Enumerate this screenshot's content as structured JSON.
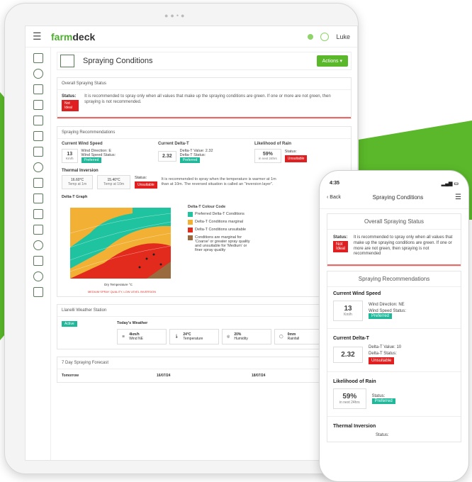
{
  "tablet": {
    "logo_a": "farm",
    "logo_b": "deck",
    "user": "Luke",
    "page_title": "Spraying Conditions",
    "actions": "Actions ▾",
    "overall": {
      "heading": "Overall Spraying Status",
      "status_label": "Status:",
      "status_value": "Not Ideal",
      "message": "It is recommended to spray only when all values that make up the spraying conditions are green. If one or more are not green, then spraying is not recommended."
    },
    "recs": {
      "heading": "Spraying Recommendations",
      "wind": {
        "title": "Current Wind Speed",
        "value": "13",
        "unit": "Km/h",
        "direction_label": "Wind Direction: E",
        "status_label": "Wind Speed Status:",
        "status": "Preferred"
      },
      "delta": {
        "title": "Current Delta-T",
        "value": "2.32",
        "dt_label": "Delta-T Value: 2.32",
        "status_label": "Delta-T Status:",
        "status": "Preferred"
      },
      "rain": {
        "title": "Likelihood of Rain",
        "value": "59%",
        "sub": "in next 24hrs",
        "status_label": "Status:",
        "status": "Unsuitable"
      }
    },
    "thermal": {
      "title": "Thermal Inversion",
      "t1": "16.60°C",
      "t1_sub": "Temp at 1m",
      "t2": "15.40°C",
      "t2_sub": "Temp at 10m",
      "status_label": "Status:",
      "status": "Unsuitable",
      "message": "It is recommended to spray when the temperature is warmer at 1m than at 10m. The reversed situation is called an \"inversion layer\"."
    },
    "graph": {
      "title": "Delta-T Graph",
      "legend_title": "Delta-T Colour Code",
      "legend": [
        {
          "label": "Preferred Delta-T Conditions",
          "color": "#1fc3a0"
        },
        {
          "label": "Delta-T Conditions marginal",
          "color": "#f2b134"
        },
        {
          "label": "Delta-T Conditions unsuitable",
          "color": "#e22b1d"
        },
        {
          "label": "Conditions are marginal for 'Coarse' or greater spray quality and unsuitable for 'Medium' or finer spray quality",
          "color": "#9a6b3f"
        }
      ],
      "xlabel": "Dry Temperature °C",
      "footer": "MEDIUM SPRAY QUALITY, LOW LEVEL INVERSION"
    },
    "weather": {
      "heading": "Llanelli Weather Station",
      "active": "Active",
      "today": "Today's Weather",
      "items": [
        {
          "v": "4km/h",
          "l": "Wind NE"
        },
        {
          "v": "24°C",
          "l": "Temperature"
        },
        {
          "v": "20%",
          "l": "Humidity"
        },
        {
          "v": "0mm",
          "l": "Rainfall"
        }
      ]
    },
    "forecast": {
      "heading": "7 Day Spraying Forecast",
      "cols": [
        "Tomorrow",
        "16/07/24",
        "18/07/24"
      ]
    }
  },
  "phone": {
    "time": "4:35",
    "back": "Back",
    "title": "Spraying Conditions",
    "overall_heading": "Overall Spraying Status",
    "status_label": "Status:",
    "status_value": "Not Ideal",
    "message": "It is recommended to spray only when all values that make up the spraying conditions are green. If one or more are not green, then spraying is not recommended",
    "recs_heading": "Spraying Recommendations",
    "wind": {
      "title": "Current Wind Speed",
      "value": "13",
      "unit": "Km/h",
      "direction": "Wind Direction: NE",
      "status_label": "Wind Speed Status:",
      "status": "Preferred"
    },
    "delta": {
      "title": "Current Delta-T",
      "value": "2.32",
      "dt_label": "Delta-T Value: 10",
      "status_label": "Delta-T Status:",
      "status": "Unsuitable"
    },
    "rain": {
      "title": "Likelihood of Rain",
      "value": "59%",
      "sub": "in next 24hrs",
      "status_label": "Status:",
      "status": "Preferred"
    },
    "thermal_title": "Thermal Inversion",
    "thermal_status": "Status:"
  }
}
